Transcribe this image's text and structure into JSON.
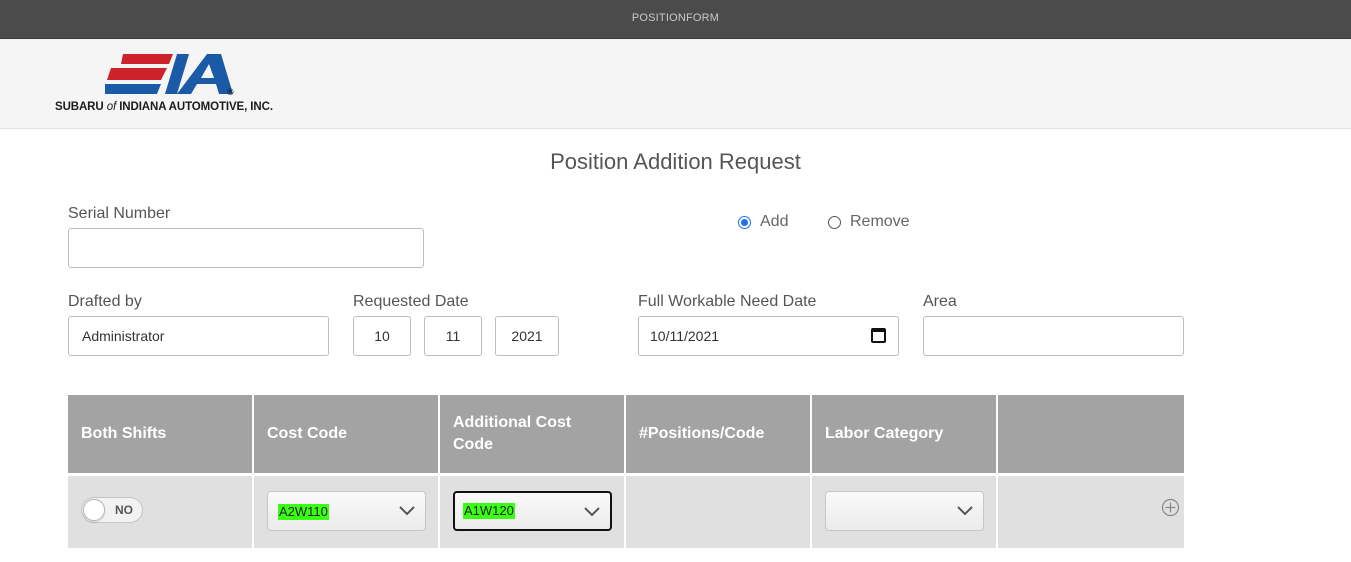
{
  "topbar": {
    "title": "POSITIONFORM"
  },
  "logo": {
    "brand_text_1": "SUBARU ",
    "brand_text_of": "of",
    "brand_text_2": " INDIANA AUTOMOTIVE, INC."
  },
  "page_title": "Position Addition Request",
  "serial_number": {
    "label": "Serial Number",
    "value": ""
  },
  "action": {
    "options": [
      {
        "label": "Add",
        "selected": true
      },
      {
        "label": "Remove",
        "selected": false
      }
    ]
  },
  "drafted_by": {
    "label": "Drafted by",
    "value": "Administrator"
  },
  "requested_date": {
    "label": "Requested Date",
    "month": "10",
    "day": "11",
    "year": "2021"
  },
  "workable_need_date": {
    "label": "Full Workable Need Date",
    "value": "10/11/2021"
  },
  "area": {
    "label": "Area",
    "value": ""
  },
  "table": {
    "headers": [
      "Both Shifts",
      "Cost Code",
      "Additional Cost Code",
      "#Positions/Code",
      "Labor Category",
      ""
    ],
    "row": {
      "both_shifts": "NO",
      "cost_code": "A2W110",
      "additional_cost_code": "A1W120",
      "positions_code": "",
      "labor_category": ""
    }
  },
  "colors": {
    "header_bar": "#4b4b4b",
    "table_header": "#a3a3a3",
    "highlight": "#39ff14",
    "radio_accent": "#1a73e8"
  },
  "icons": [
    "calendar-icon",
    "chevron-down-icon",
    "add-row-icon"
  ]
}
